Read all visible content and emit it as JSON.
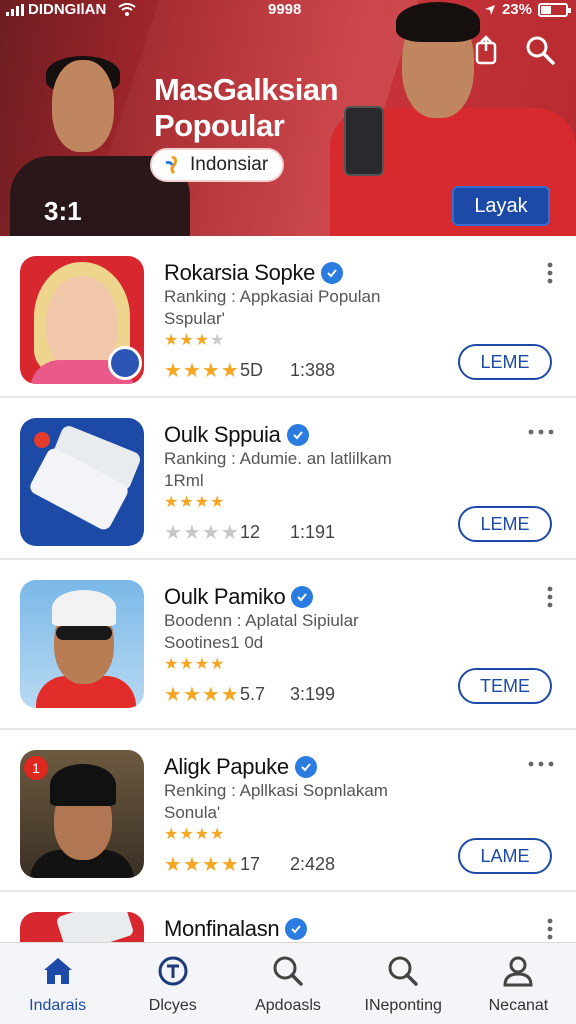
{
  "status_bar": {
    "carrier": "DIDNGIlAN",
    "time": "9998",
    "battery": "23%"
  },
  "hero": {
    "title_line1": "MasGalksian",
    "title_line2": "Popoular",
    "pill_label": "Indonsiar",
    "counter": "3:1",
    "cta_label": "Layak"
  },
  "apps": [
    {
      "name": "Rokarsia Sopke",
      "desc_line1": "Ranking :  Appkasiai Populan",
      "desc_line2": "Sspular'",
      "small_stars": 3,
      "big_stars": 4,
      "rating_count": "5D",
      "downloads": "1:388",
      "action": "LEME",
      "more": "vertical"
    },
    {
      "name": "Oulk Sppuia",
      "desc_line1": "Ranking :  Adumie. an latlilkam",
      "desc_line2": "1Rml",
      "small_stars": 4,
      "big_stars": 0,
      "rating_count": "12",
      "downloads": "1:191",
      "action": "LEME",
      "more": "horizontal"
    },
    {
      "name": "Oulk Pamiko",
      "desc_line1": "Boodenn :  Aplatal Sipiular",
      "desc_line2": "Sootines1 0d",
      "small_stars": 4,
      "big_stars": 4,
      "rating_count": "5.7",
      "downloads": "3:199",
      "action": "TEME",
      "more": "vertical"
    },
    {
      "name": "Aligk Papuke",
      "desc_line1": "Renking :  Apllkasi Sopnlakam",
      "desc_line2": "Sonula'",
      "small_stars": 4,
      "big_stars": 4,
      "rating_count": "17",
      "downloads": "2:428",
      "action": "LAME",
      "more": "horizontal",
      "notification": "1"
    },
    {
      "name": "Monfinalasn",
      "more": "vertical"
    }
  ],
  "bottom_nav": [
    {
      "label": "Indarais",
      "icon": "home-icon",
      "active": true
    },
    {
      "label": "Dlcyes",
      "icon": "timer-icon",
      "active": false
    },
    {
      "label": "Apdoasls",
      "icon": "search-icon",
      "active": false
    },
    {
      "label": "INeponting",
      "icon": "search-icon",
      "active": false
    },
    {
      "label": "Necanat",
      "icon": "profile-icon",
      "active": false
    }
  ],
  "colors": {
    "hero_red": "#c8353a",
    "accent_blue": "#1d4aa7",
    "star": "#f5a623",
    "verified": "#2a7ce0"
  }
}
